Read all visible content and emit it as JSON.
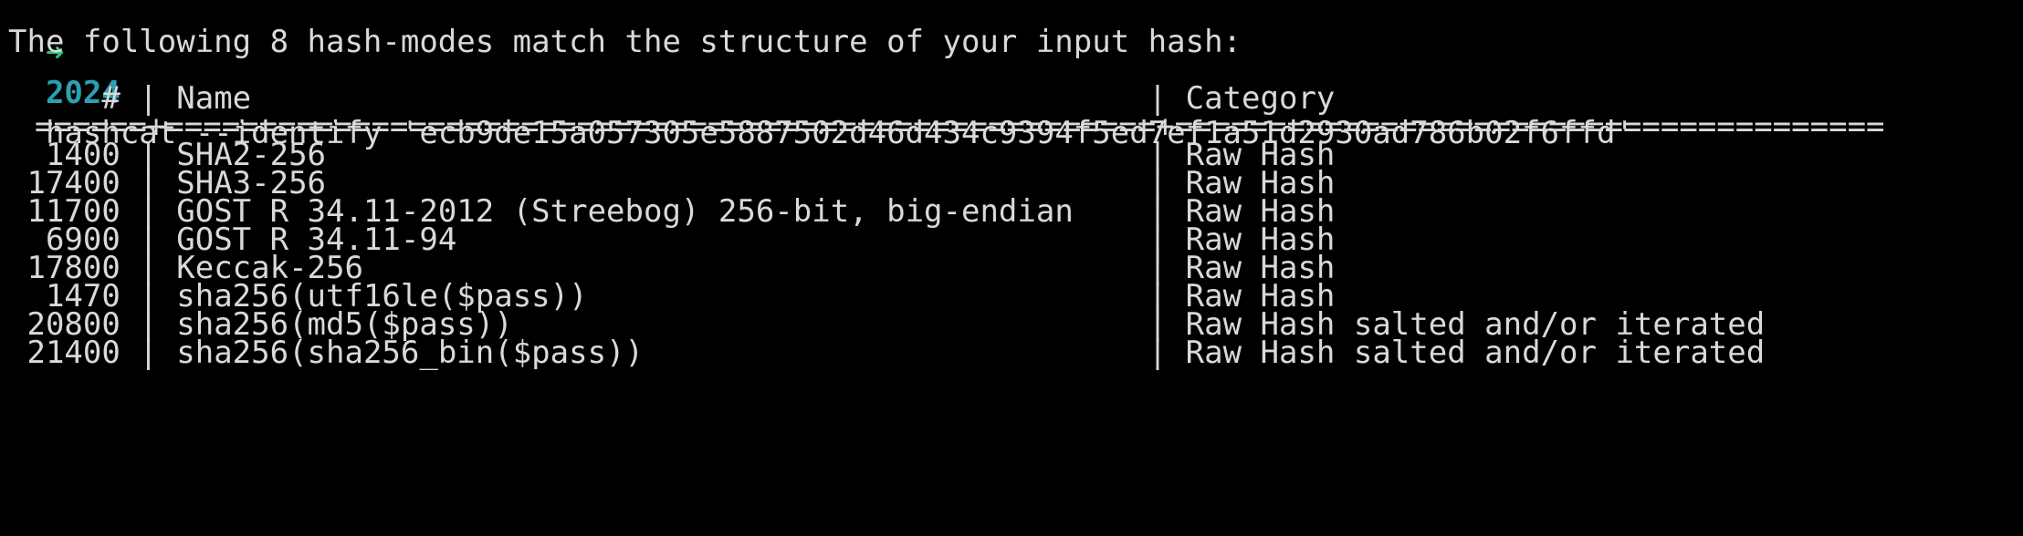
{
  "prompt": {
    "arrow": "➜",
    "directory": "2024",
    "command": "hashcat --identify 'ecb9de15a057305e5887502d46d434c9394f5ed7ef1a51d2930ad786b02f6ffd'"
  },
  "message": "The following 8 hash-modes match the structure of your input hash:",
  "table": {
    "header": {
      "num": "     # ",
      "name": " Name                                                ",
      "category": " Category"
    },
    "separator": "======+=====================================================+======================================",
    "rows": [
      {
        "num": "  1400 ",
        "name": " SHA2-256                                            ",
        "category": " Raw Hash"
      },
      {
        "num": " 17400 ",
        "name": " SHA3-256                                            ",
        "category": " Raw Hash"
      },
      {
        "num": " 11700 ",
        "name": " GOST R 34.11-2012 (Streebog) 256-bit, big-endian    ",
        "category": " Raw Hash"
      },
      {
        "num": "  6900 ",
        "name": " GOST R 34.11-94                                     ",
        "category": " Raw Hash"
      },
      {
        "num": " 17800 ",
        "name": " Keccak-256                                          ",
        "category": " Raw Hash"
      },
      {
        "num": "  1470 ",
        "name": " sha256(utf16le($pass))                              ",
        "category": " Raw Hash"
      },
      {
        "num": " 20800 ",
        "name": " sha256(md5($pass))                                  ",
        "category": " Raw Hash salted and/or iterated"
      },
      {
        "num": " 21400 ",
        "name": " sha256(sha256_bin($pass))                           ",
        "category": " Raw Hash salted and/or iterated"
      }
    ]
  },
  "colors": {
    "background": "#000000",
    "text": "#d9d9d9",
    "prompt_arrow": "#2ec27e",
    "prompt_dir": "#2aa1b3"
  }
}
